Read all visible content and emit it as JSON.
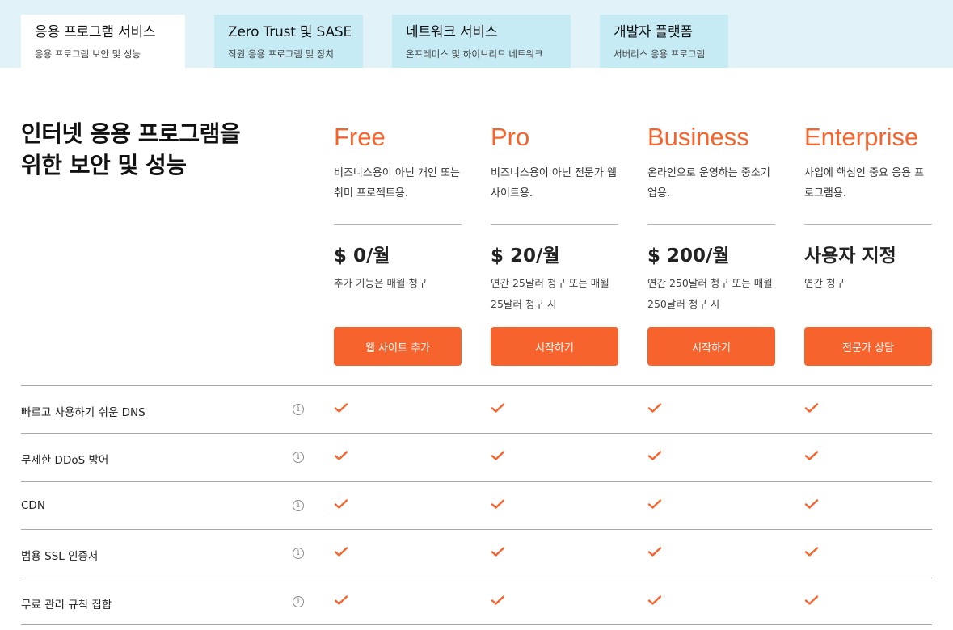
{
  "tabs": [
    {
      "title": "응용 프로그램 서비스",
      "subtitle": "응용 프로그램 보안 및 성능",
      "active": true
    },
    {
      "title": "Zero Trust 및 SASE",
      "subtitle": "직원 응용 프로그램 및 장치",
      "active": false
    },
    {
      "title": "네트워크 서비스",
      "subtitle": "온프레미스 및 하이브리드 네트워크",
      "active": false
    },
    {
      "title": "개발자 플랫폼",
      "subtitle": "서버리스 응용 프로그램",
      "active": false
    }
  ],
  "heading": {
    "line1": "인터넷 응용 프로그램을",
    "line2": "위한 보안 및 성능"
  },
  "plans": [
    {
      "name": "Free",
      "desc": "비즈니스용이 아닌 개인 또는 취미 프로젝트용.",
      "price": "$ 0/월",
      "note": "추가 기능은 매월 청구",
      "button": "웹 사이트 추가"
    },
    {
      "name": "Pro",
      "desc": "비즈니스용이 아닌 전문가 웹 사이트용.",
      "price": "$ 20/월",
      "note": "연간 25달러 청구 또는 매월 25달러 청구 시",
      "button": "시작하기"
    },
    {
      "name": "Business",
      "desc": "온라인으로 운영하는 중소기업용.",
      "price": "$ 200/월",
      "note": "연간 250달러 청구 또는 매월 250달러 청구 시",
      "button": "시작하기"
    },
    {
      "name": "Enterprise",
      "desc": "사업에 핵심인 중요 응용 프로그램용.",
      "price": "사용자 지정",
      "note": "연간 청구",
      "button": "전문가 상담"
    }
  ],
  "features": [
    {
      "label": "빠르고 사용하기 쉬운 DNS",
      "included": [
        true,
        true,
        true,
        true
      ]
    },
    {
      "label": "무제한 DDoS 방어",
      "included": [
        true,
        true,
        true,
        true
      ]
    },
    {
      "label": "CDN",
      "included": [
        true,
        true,
        true,
        true
      ]
    },
    {
      "label": "범용 SSL 인증서",
      "included": [
        true,
        true,
        true,
        true
      ]
    },
    {
      "label": "무료 관리 규칙 집합",
      "included": [
        true,
        true,
        true,
        true
      ]
    }
  ],
  "icons": {
    "info": "info-icon",
    "check": "check-icon"
  },
  "colors": {
    "accent": "#f6632d",
    "tab_bar": "#e1f3f8",
    "tab_inactive": "#c6ebf4",
    "tab_active": "#ffffff"
  }
}
